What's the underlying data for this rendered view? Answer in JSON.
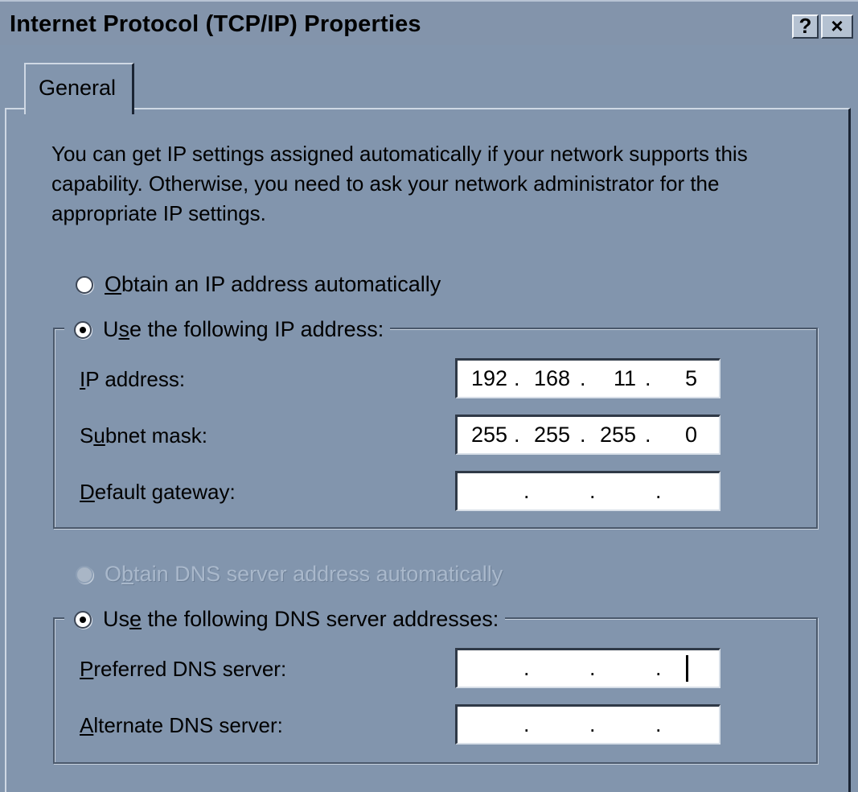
{
  "window": {
    "title": "Internet Protocol (TCP/IP) Properties",
    "help_label": "?",
    "close_label": "×"
  },
  "tabs": [
    {
      "label": "General"
    }
  ],
  "description": "You can get IP settings assigned automatically if your network supports this capability. Otherwise, you need to ask your network administrator for the appropriate IP settings.",
  "ip_mode": {
    "auto": {
      "label_pre": "",
      "mnemonic": "O",
      "label_post": "btain an IP address automatically",
      "checked": false
    },
    "manual": {
      "label_pre": "U",
      "mnemonic": "s",
      "label_post": "e the following IP address:",
      "checked": true
    }
  },
  "ip_fields": [
    {
      "label_pre": "",
      "mnemonic": "I",
      "label_post": "P address:",
      "octets": [
        "192",
        "168",
        "11",
        "5"
      ]
    },
    {
      "label_pre": "S",
      "mnemonic": "u",
      "label_post": "bnet mask:",
      "octets": [
        "255",
        "255",
        "255",
        "0"
      ]
    },
    {
      "label_pre": "",
      "mnemonic": "D",
      "label_post": "efault gateway:",
      "octets": [
        "",
        "",
        "",
        ""
      ]
    }
  ],
  "dns_mode": {
    "auto": {
      "label_pre": "O",
      "mnemonic": "b",
      "label_post": "tain DNS server address automatically",
      "checked": false,
      "disabled": true
    },
    "manual": {
      "label_pre": "Us",
      "mnemonic": "e",
      "label_post": " the following DNS server addresses:",
      "checked": true
    }
  },
  "dns_fields": [
    {
      "label_pre": "",
      "mnemonic": "P",
      "label_post": "referred DNS server:",
      "octets": [
        "",
        "",
        "",
        ""
      ]
    },
    {
      "label_pre": "",
      "mnemonic": "A",
      "label_post": "lternate DNS server:",
      "octets": [
        "",
        "",
        "",
        ""
      ]
    }
  ],
  "octet_separator": "."
}
